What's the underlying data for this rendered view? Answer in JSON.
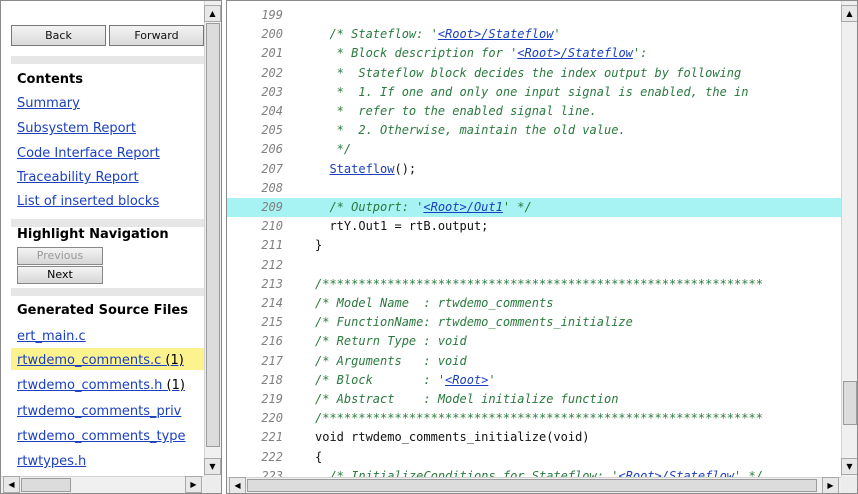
{
  "navigation": {
    "back_label": "Back",
    "forward_label": "Forward"
  },
  "contents": {
    "title": "Contents",
    "items": [
      "Summary",
      "Subsystem Report",
      "Code Interface Report",
      "Traceability Report",
      "List of inserted blocks"
    ]
  },
  "highlight": {
    "title": "Highlight Navigation",
    "previous_label": "Previous",
    "next_label": "Next",
    "previous_enabled": false
  },
  "sources": {
    "title": "Generated Source Files",
    "files": [
      {
        "name": "ert_main.c",
        "count": ""
      },
      {
        "name": "rtwdemo_comments.c",
        "count": "(1)",
        "highlighted": true
      },
      {
        "name": "rtwdemo_comments.h",
        "count": "(1)"
      },
      {
        "name": "rtwdemo_comments_priv",
        "count": ""
      },
      {
        "name": "rtwdemo_comments_type",
        "count": ""
      },
      {
        "name": "rtwtypes.h",
        "count": ""
      }
    ]
  },
  "code": {
    "highlight_color": "#a7f2f3",
    "lines": [
      {
        "n": "199",
        "text": ""
      },
      {
        "n": "200",
        "text": "  /* Stateflow: '<Root>/Stateflow'"
      },
      {
        "n": "201",
        "text": "   * Block description for '<Root>/Stateflow':"
      },
      {
        "n": "202",
        "text": "   *  Stateflow block decides the index output by following"
      },
      {
        "n": "203",
        "text": "   *  1. If one and only one input signal is enabled, the in"
      },
      {
        "n": "204",
        "text": "   *  refer to the enabled signal line."
      },
      {
        "n": "205",
        "text": "   *  2. Otherwise, maintain the old value."
      },
      {
        "n": "206",
        "text": "   */"
      },
      {
        "n": "207",
        "text": "  Stateflow();"
      },
      {
        "n": "208",
        "text": ""
      },
      {
        "n": "209",
        "text": "  /* Outport: '<Root>/Out1' */",
        "highlighted": true
      },
      {
        "n": "210",
        "text": "  rtY.Out1 = rtB.output;"
      },
      {
        "n": "211",
        "text": "}"
      },
      {
        "n": "212",
        "text": ""
      },
      {
        "n": "213",
        "text": "/*************************************************************"
      },
      {
        "n": "214",
        "text": "/* Model Name  : rtwdemo_comments"
      },
      {
        "n": "215",
        "text": "/* FunctionName: rtwdemo_comments_initialize"
      },
      {
        "n": "216",
        "text": "/* Return Type : void"
      },
      {
        "n": "217",
        "text": "/* Arguments   : void"
      },
      {
        "n": "218",
        "text": "/* Block       : '<Root>'"
      },
      {
        "n": "219",
        "text": "/* Abstract    : Model initialize function"
      },
      {
        "n": "220",
        "text": "/*************************************************************"
      },
      {
        "n": "221",
        "text": "void rtwdemo_comments_initialize(void)"
      },
      {
        "n": "222",
        "text": "{"
      },
      {
        "n": "223",
        "text": "  /* InitializeConditions for Stateflow: '<Root>/Stateflow' */"
      }
    ]
  }
}
